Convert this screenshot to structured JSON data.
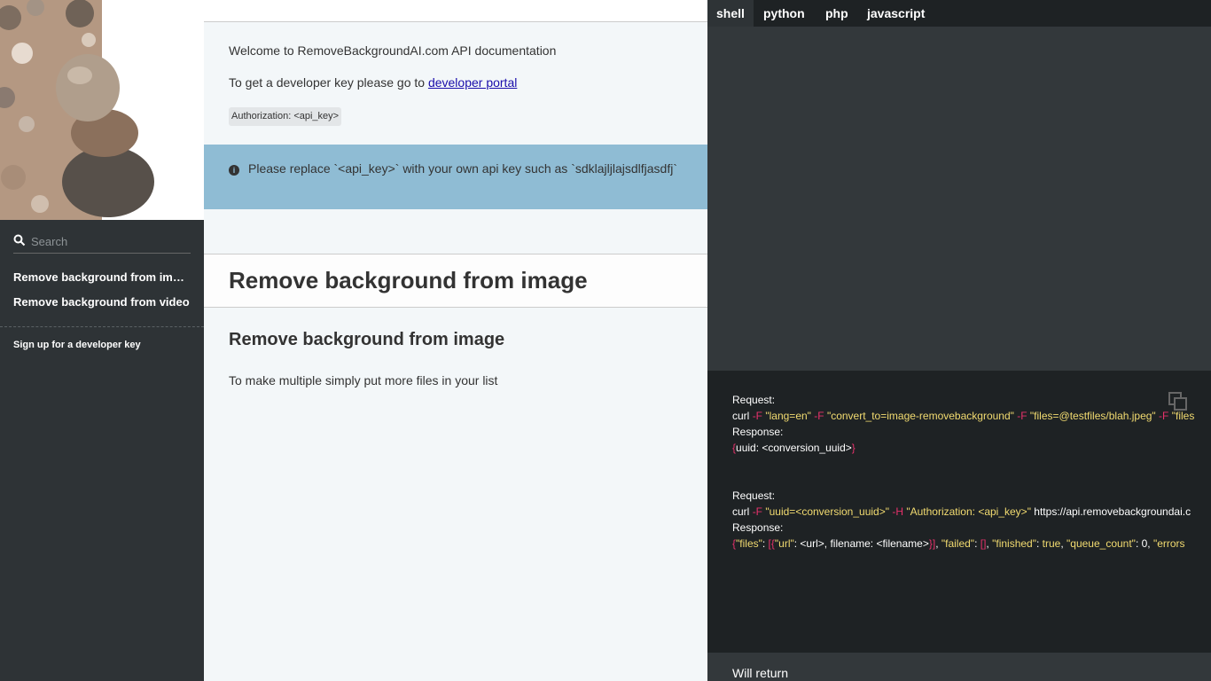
{
  "sidebar": {
    "search_placeholder": "Search",
    "items": [
      {
        "label": "Remove background from image"
      },
      {
        "label": "Remove background from video"
      }
    ],
    "signup_label": "Sign up for a developer key"
  },
  "content": {
    "welcome": "Welcome to RemoveBackgroundAI.com API documentation",
    "devkey_text": "To get a developer key please go to ",
    "devkey_link": "developer portal",
    "auth_code": "Authorization: <api_key>",
    "aside_text": "Please replace `<api_key>` with your own api key such as `sdklajljlajsdlfjasdfj`",
    "h1": "Remove background from image",
    "h2": "Remove background from image",
    "body_text": "To make multiple simply put more files in your list"
  },
  "lang_tabs": [
    "shell",
    "python",
    "php",
    "javascript"
  ],
  "active_lang": "shell",
  "code": {
    "request_label": "Request:",
    "response_label": "Response:",
    "curl": "curl",
    "flag_f": "-F",
    "flag_h": "-H",
    "arg_lang": "\"lang=en\"",
    "arg_convert": "\"convert_to=image-removebackground\"",
    "arg_files": "\"files=@testfiles/blah.jpeg\"",
    "arg_files2": "\"files",
    "resp1_open": "{",
    "resp1_body": "uuid: <conversion_uuid>",
    "resp1_close": "}",
    "arg_uuid": "\"uuid=<conversion_uuid>\"",
    "arg_auth": "\"Authorization: <api_key>\"",
    "url2": "https://api.removebackgroundai.c",
    "r2_1": "{",
    "r2_2": "\"files\"",
    "r2_3": ": ",
    "r2_4": "[{",
    "r2_5": "\"url\"",
    "r2_6": ": <url>, filename: <filename>",
    "r2_7": "}]",
    "r2_8": ", ",
    "r2_9": "\"failed\"",
    "r2_10": ": ",
    "r2_11": "[]",
    "r2_12": ", ",
    "r2_13": "\"finished\"",
    "r2_14": ": ",
    "r2_15": "true",
    "r2_16": ", ",
    "r2_17": "\"queue_count\"",
    "r2_18": ": 0, ",
    "r2_19": "\"errors"
  },
  "will_return": "Will return",
  "colors": {
    "sidebar_bg": "#2e3336",
    "code_bg": "#1e2224",
    "aside_bg": "#8fbcd4",
    "string": "#f2db70",
    "keyword": "#e6316b"
  }
}
